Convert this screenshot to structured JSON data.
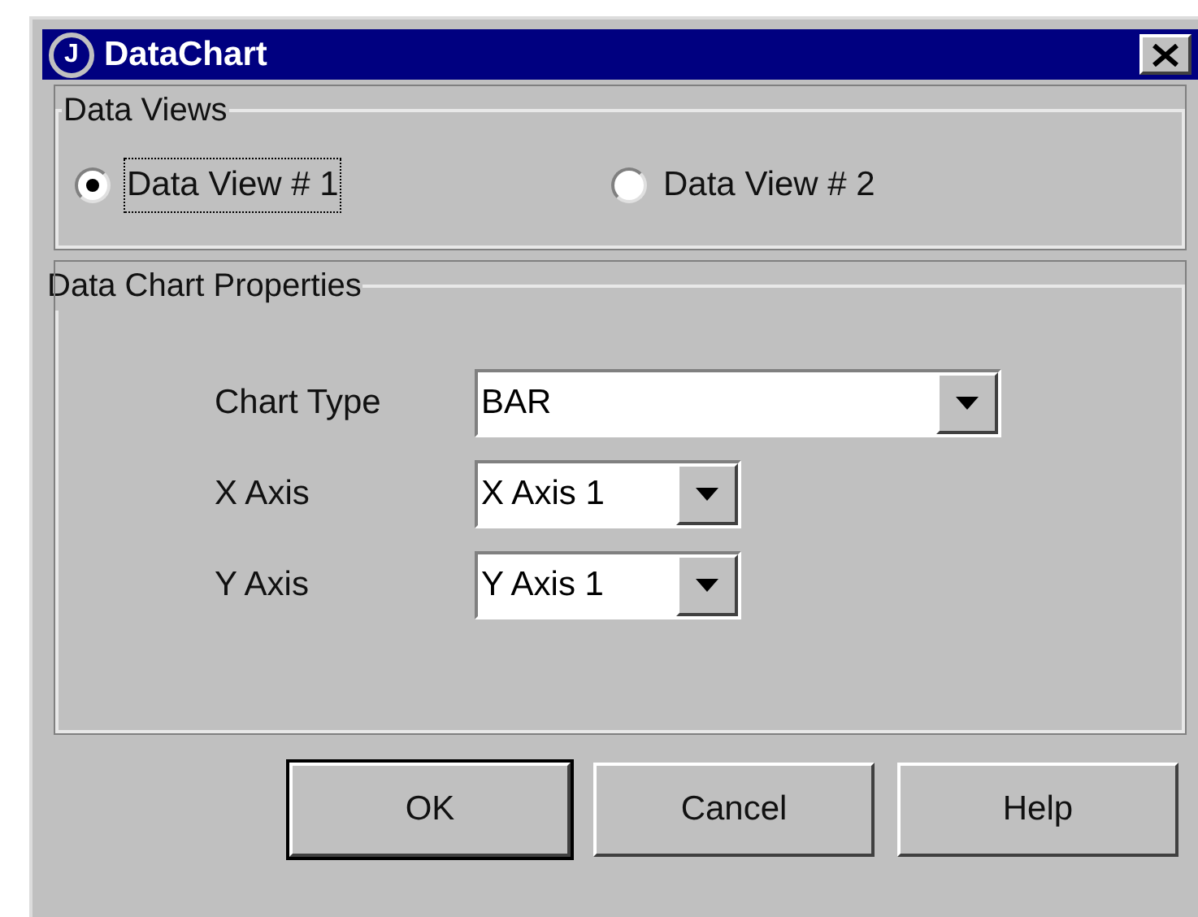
{
  "window": {
    "title": "DataChart",
    "logo_letter": "J"
  },
  "data_views": {
    "title": "Data Views",
    "options": [
      {
        "label": "Data View # 1",
        "selected": true,
        "focused": true
      },
      {
        "label": "Data View # 2",
        "selected": false,
        "focused": false
      }
    ]
  },
  "properties": {
    "title": "Data Chart Properties",
    "fields": [
      {
        "label": "Chart Type",
        "value": "BAR",
        "wide": true
      },
      {
        "label": "X Axis",
        "value": "X Axis 1",
        "wide": false
      },
      {
        "label": "Y Axis",
        "value": "Y Axis 1",
        "wide": false
      }
    ]
  },
  "buttons": [
    {
      "label": "OK",
      "default": true
    },
    {
      "label": "Cancel",
      "default": false
    },
    {
      "label": "Help",
      "default": false
    }
  ]
}
